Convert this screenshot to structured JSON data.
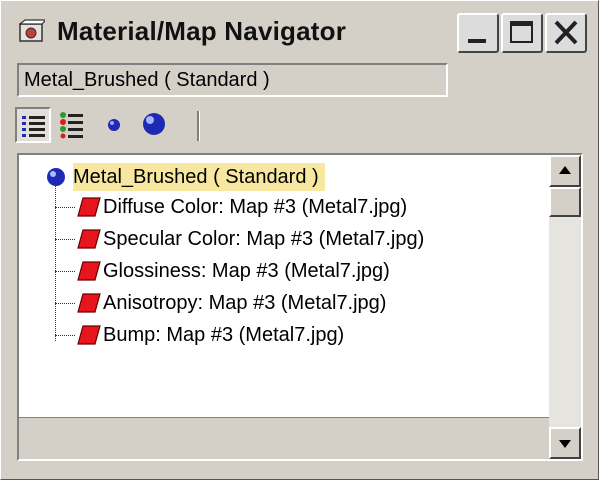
{
  "window": {
    "title": "Material/Map Navigator",
    "buttons": {
      "minimize": "minimize",
      "maximize": "maximize",
      "close": "close"
    }
  },
  "name_field": {
    "value": "Metal_Brushed  ( Standard )"
  },
  "toolbar": {
    "tools": [
      {
        "icon": "list-view-icon",
        "pressed": true
      },
      {
        "icon": "list-icons-view-icon",
        "pressed": false
      },
      {
        "icon": "small-icons-view-icon",
        "pressed": false
      },
      {
        "icon": "large-icons-view-icon",
        "pressed": false
      }
    ]
  },
  "tree": {
    "root": {
      "label": "Metal_Brushed  ( Standard )",
      "icon": "material-sphere-icon"
    },
    "children": [
      {
        "label": "Diffuse Color: Map #3 (Metal7.jpg)",
        "icon": "map-parallelogram-icon"
      },
      {
        "label": "Specular Color: Map #3 (Metal7.jpg)",
        "icon": "map-parallelogram-icon"
      },
      {
        "label": "Glossiness: Map #3 (Metal7.jpg)",
        "icon": "map-parallelogram-icon"
      },
      {
        "label": "Anisotropy: Map #3 (Metal7.jpg)",
        "icon": "map-parallelogram-icon"
      },
      {
        "label": "Bump: Map #3 (Metal7.jpg)",
        "icon": "map-parallelogram-icon"
      }
    ]
  },
  "colors": {
    "window_bg": "#d4d0c8",
    "root_highlight": "#f7e7a0",
    "map_icon_red": "#e8141e",
    "sphere_blue": "#1e2ab4"
  }
}
